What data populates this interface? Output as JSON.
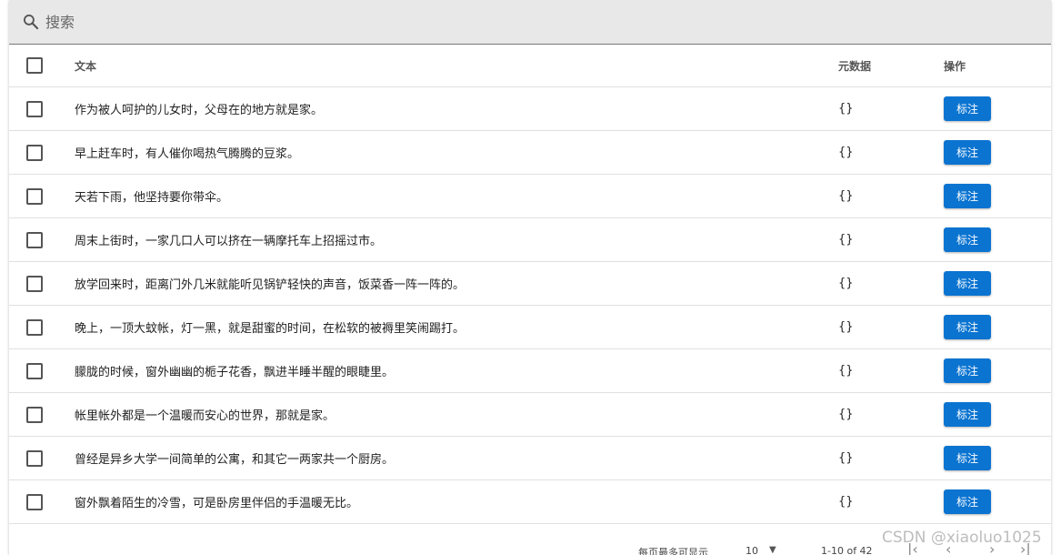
{
  "search": {
    "placeholder": "搜索"
  },
  "table": {
    "columns": {
      "text": "文本",
      "meta": "元数据",
      "action": "操作"
    },
    "rows": [
      {
        "text": "作为被人呵护的儿女时，父母在的地方就是家。",
        "meta": "{}",
        "action": "标注"
      },
      {
        "text": "早上赶车时，有人催你喝热气腾腾的豆浆。",
        "meta": "{}",
        "action": "标注"
      },
      {
        "text": "天若下雨，他坚持要你带伞。",
        "meta": "{}",
        "action": "标注"
      },
      {
        "text": "周末上街时，一家几口人可以挤在一辆摩托车上招摇过市。",
        "meta": "{}",
        "action": "标注"
      },
      {
        "text": "放学回来时，距离门外几米就能听见锅铲轻快的声音，饭菜香一阵一阵的。",
        "meta": "{}",
        "action": "标注"
      },
      {
        "text": "晚上，一顶大蚊帐，灯一黑，就是甜蜜的时间，在松软的被褥里笑闹踢打。",
        "meta": "{}",
        "action": "标注"
      },
      {
        "text": "朦胧的时候，窗外幽幽的栀子花香，飘进半睡半醒的眼睫里。",
        "meta": "{}",
        "action": "标注"
      },
      {
        "text": "帐里帐外都是一个温暖而安心的世界，那就是家。",
        "meta": "{}",
        "action": "标注"
      },
      {
        "text": "曾经是异乡大学一间简单的公寓，和其它一两家共一个厨房。",
        "meta": "{}",
        "action": "标注"
      },
      {
        "text": "窗外飘着陌生的冷雪，可是卧房里伴侣的手温暖无比。",
        "meta": "{}",
        "action": "标注"
      }
    ]
  },
  "pagination": {
    "rows_per_page_label": "每页最多可显示",
    "rows_per_page_value": "10",
    "range_label": "1-10 of 42",
    "first_icon": "first-page-icon",
    "prev_icon": "chevron-left-icon",
    "next_icon": "chevron-right-icon",
    "last_icon": "last-page-icon"
  },
  "watermark": "CSDN @xiaoluo1025",
  "colors": {
    "accent": "#0b74d1",
    "search_bg": "#e8e8e8"
  }
}
